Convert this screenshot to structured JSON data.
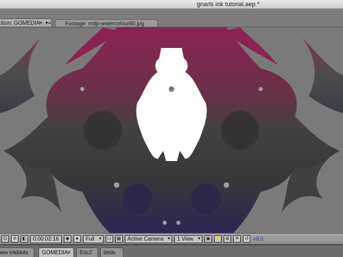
{
  "window": {
    "title": "gnarls ink tutorial.aep *"
  },
  "panel_tabs": {
    "composition_label": "ition: GOMEDIA",
    "composition_close": "✕",
    "composition_menu": "▾≡",
    "footage_label": "Footage: mdp-watercolour60.jpg"
  },
  "viewer_toolbar": {
    "timecode": "0:00:02:16",
    "resolution": "Full",
    "camera": "Active Camera",
    "views": "1 View",
    "exposure": "+0.0"
  },
  "timeline_tabs": [
    {
      "label": "new inkblots",
      "active": false
    },
    {
      "label": "GOMEDIA",
      "active": true,
      "close": "✕"
    },
    {
      "label": "Eric2",
      "active": false
    },
    {
      "label": "birds",
      "active": false
    }
  ],
  "colors": {
    "ink_top": "#8c1f52",
    "ink_mid": "#3e3e3e",
    "ink_bottom": "#2a2250",
    "viewer_bg": "#7a7a7a",
    "exposure_text": "#1a3fa8"
  }
}
